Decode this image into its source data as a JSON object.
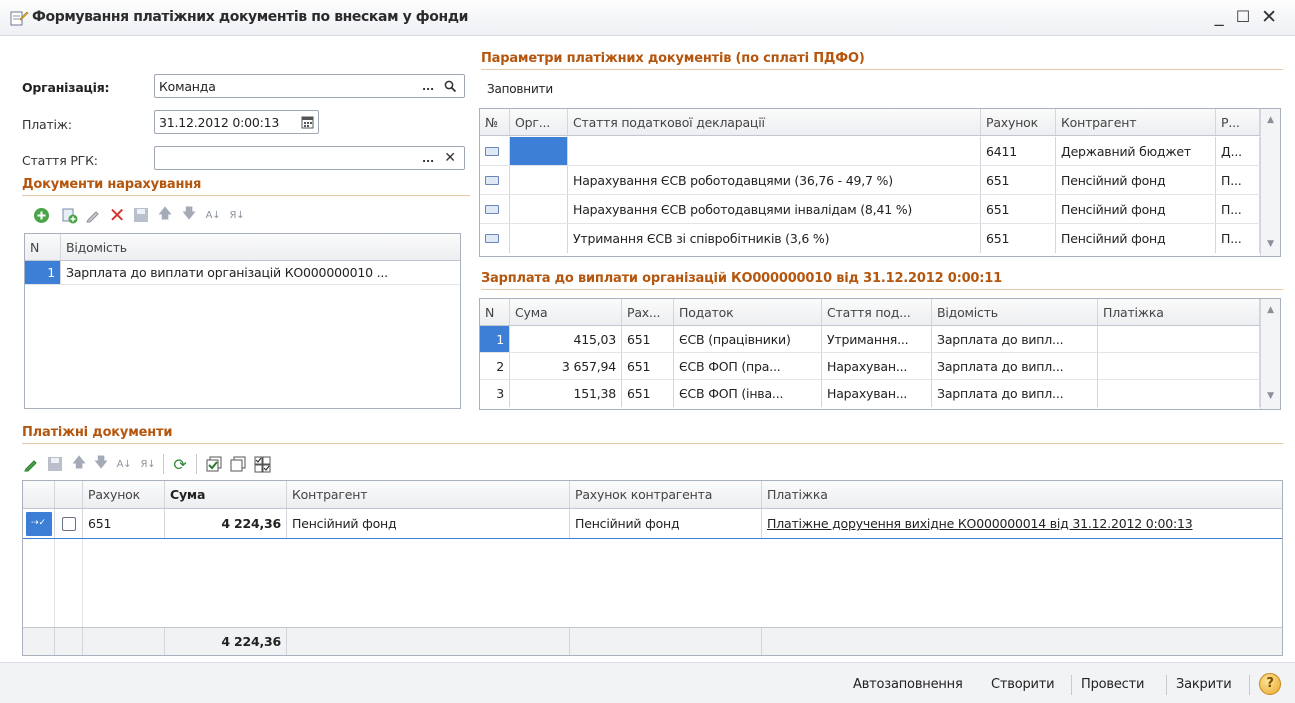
{
  "window": {
    "title": "Формування платіжних документів по внескам у фонди",
    "icon": "document-edit-icon"
  },
  "form": {
    "org_label": "Організація:",
    "org_value": "Команда",
    "payment_label": "Платіж:",
    "payment_value": "31.12.2012  0:00:13",
    "article_label": "Стаття РГК:",
    "article_value": ""
  },
  "accrual_docs": {
    "title": "Документи нарахування",
    "columns": [
      "N",
      "Відомість"
    ],
    "rows": [
      {
        "n": "1",
        "statement": "Зарплата до виплати організацій КО000000010 ..."
      }
    ]
  },
  "params": {
    "title": "Параметри платіжних документів (по сплаті ПДФО)",
    "fill_button": "Заповнити",
    "columns": [
      "№",
      "Орг...",
      "Стаття податкової декларації",
      "Рахунок",
      "Контрагент",
      "Р..."
    ],
    "rows": [
      {
        "org": "",
        "article": "",
        "account": "6411",
        "counterparty": "Державний бюджет",
        "r": "Д..."
      },
      {
        "org": "",
        "article": "Нарахування ЄСВ роботодавцями (36,76 - 49,7 %)",
        "account": "651",
        "counterparty": "Пенсійний фонд",
        "r": "П..."
      },
      {
        "org": "",
        "article": "Нарахування ЄСВ роботодавцями інвалідам (8,41 %)",
        "account": "651",
        "counterparty": "Пенсійний фонд",
        "r": "П..."
      },
      {
        "org": "",
        "article": "Утримання ЄСВ зі співробітників (3,6 %)",
        "account": "651",
        "counterparty": "Пенсійний фонд",
        "r": "П..."
      }
    ]
  },
  "salary": {
    "title": "Зарплата до виплати організацій КО000000010 від 31.12.2012 0:00:11",
    "columns": [
      "N",
      "Сума",
      "Рах...",
      "Податок",
      "Стаття под...",
      "Відомість",
      "Платіжка"
    ],
    "rows": [
      {
        "n": "1",
        "sum": "415,03",
        "account": "651",
        "tax": "ЄСВ (працівники)",
        "article": "Утримання...",
        "statement": "Зарплата до випл...",
        "payment": ""
      },
      {
        "n": "2",
        "sum": "3 657,94",
        "account": "651",
        "tax": "ЄСВ ФОП (пра...",
        "article": "Нарахуван...",
        "statement": "Зарплата до випл...",
        "payment": ""
      },
      {
        "n": "3",
        "sum": "151,38",
        "account": "651",
        "tax": "ЄСВ ФОП (інва...",
        "article": "Нарахуван...",
        "statement": "Зарплата до випл...",
        "payment": ""
      }
    ]
  },
  "payment_docs": {
    "title": "Платіжні документи",
    "columns": [
      "",
      "",
      "Рахунок",
      "Сума",
      "Контрагент",
      "Рахунок контрагента",
      "Платіжка"
    ],
    "rows": [
      {
        "account": "651",
        "sum": "4 224,36",
        "counterparty": "Пенсійний фонд",
        "cp_account": "Пенсійний фонд",
        "payment": "Платіжне доручення вихідне КО000000014 від 31.12.2012 0:00:13"
      }
    ],
    "total": "4 224,36"
  },
  "footer": {
    "autofill": "Автозаповнення",
    "create": "Створити",
    "post": "Провести",
    "close": "Закрити",
    "help": "?"
  },
  "colors": {
    "section_title": "#b5560e",
    "selection": "#3d7fd6",
    "accent_green": "#4aa548",
    "delete_red": "#d9332b"
  }
}
